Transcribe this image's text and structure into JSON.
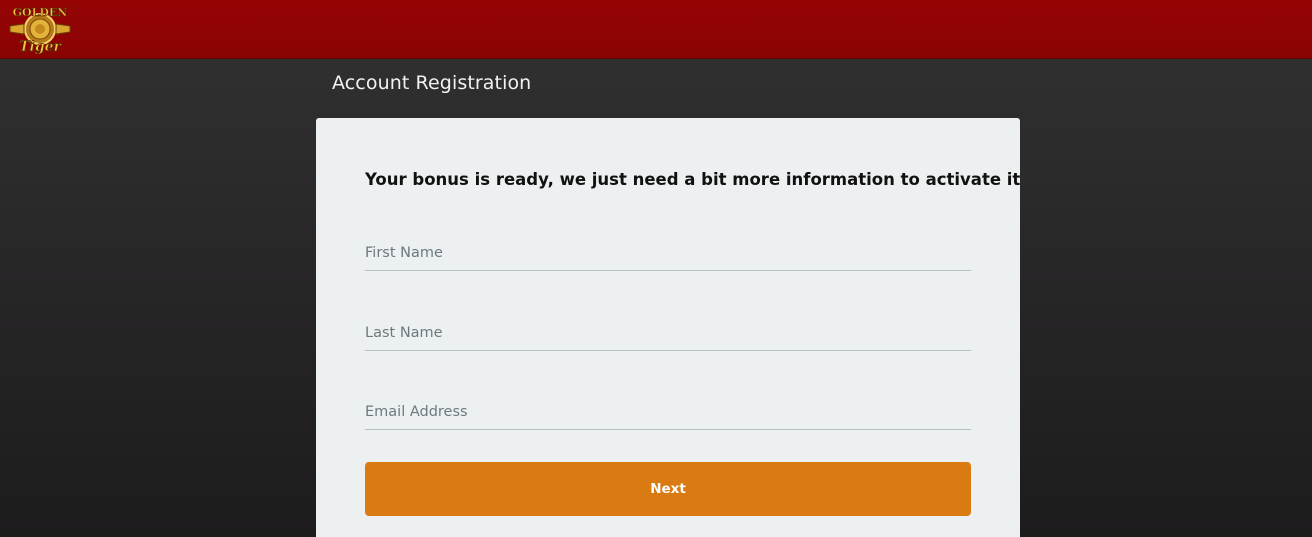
{
  "header": {
    "logo_text_top": "GOLDEN",
    "logo_text_bottom": "Tiger",
    "logo_icon": "golden-tiger-emblem-icon",
    "colors": {
      "bar": "#8f0303",
      "logo_gold": "#e8b630"
    }
  },
  "page": {
    "heading": "Account Registration",
    "background": "#2a292a"
  },
  "form": {
    "title": "Your bonus is ready, we just need a bit more information to activate it",
    "first_name_placeholder": "First Name",
    "first_name_value": "",
    "last_name_placeholder": "Last Name",
    "last_name_value": "",
    "email_placeholder": "Email Address",
    "email_value": "",
    "next_label": "Next",
    "colors": {
      "card": "#ecf0f1",
      "button": "#d97b12"
    }
  }
}
